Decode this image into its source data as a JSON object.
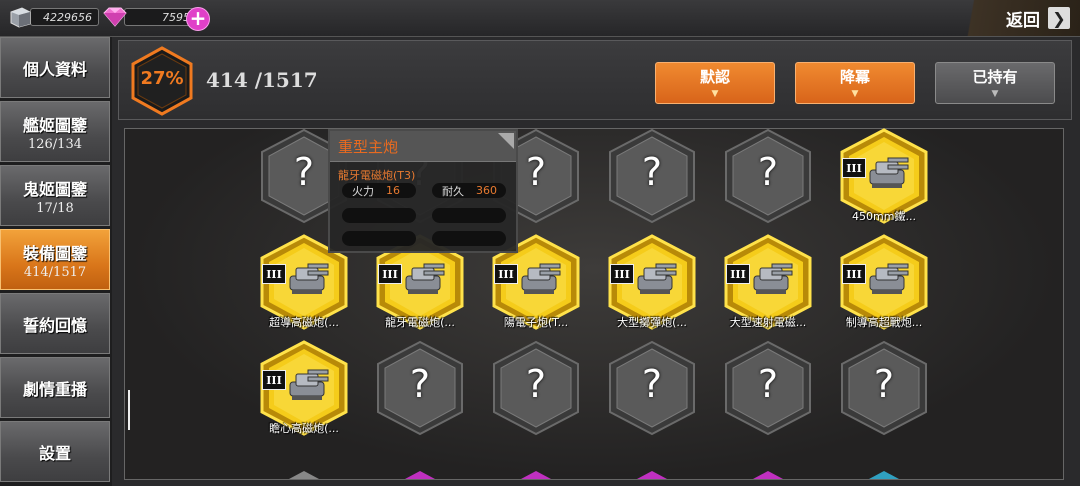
{
  "topbar": {
    "steel": "4229656",
    "gems": "7595",
    "gem_add_symbol": "+",
    "back_label": "返回",
    "back_arrow": "❯"
  },
  "sidebar": {
    "items": [
      {
        "label": "個人資料",
        "count": ""
      },
      {
        "label": "艦姬圖鑒",
        "count": "126/134"
      },
      {
        "label": "鬼姬圖鑒",
        "count": "17/18"
      },
      {
        "label": "裝備圖鑒",
        "count": "414/1517",
        "active": true
      },
      {
        "label": "誓約回憶",
        "count": ""
      },
      {
        "label": "劇情重播",
        "count": ""
      },
      {
        "label": "設置",
        "count": ""
      }
    ]
  },
  "header": {
    "percent": "27%",
    "count": "414 /1517",
    "buttons": [
      {
        "label": "默認",
        "style": "orange"
      },
      {
        "label": "降冪",
        "style": "orange"
      },
      {
        "label": "已持有",
        "style": "gray"
      }
    ],
    "dropdown_glyph": "▼"
  },
  "grid": {
    "unknown_glyph": "?",
    "tier_label": "III",
    "rows": [
      [
        {
          "state": "unknown"
        },
        {
          "state": "unknown"
        },
        {
          "state": "unknown"
        },
        {
          "state": "unknown"
        },
        {
          "state": "unknown"
        },
        {
          "state": "owned",
          "name": "450mm鐵..."
        }
      ],
      [
        {
          "state": "owned",
          "name": "超導高磁炮(..."
        },
        {
          "state": "owned",
          "name": "龍牙電磁炮(..."
        },
        {
          "state": "owned",
          "name": "陽電子炮(T..."
        },
        {
          "state": "owned",
          "name": "大型擲彈炮(..."
        },
        {
          "state": "owned",
          "name": "大型速射電磁..."
        },
        {
          "state": "owned",
          "name": "制導高超戰炮..."
        }
      ],
      [
        {
          "state": "owned",
          "name": "瞻心高磁炮(..."
        },
        {
          "state": "unknown"
        },
        {
          "state": "unknown"
        },
        {
          "state": "unknown"
        },
        {
          "state": "unknown"
        },
        {
          "state": "unknown"
        }
      ]
    ],
    "peek_colors": [
      "#888888",
      "#c030c0",
      "#c030c0",
      "#c030c0",
      "#c030c0",
      "#30a0c0"
    ]
  },
  "tooltip": {
    "category": "重型主炮",
    "item_name": "龍牙電磁炮(T3)",
    "stats": [
      {
        "key": "火力",
        "value": "16"
      },
      {
        "key": "耐久",
        "value": "360"
      },
      {
        "key": "",
        "value": ""
      },
      {
        "key": "",
        "value": ""
      },
      {
        "key": "",
        "value": ""
      },
      {
        "key": "",
        "value": ""
      }
    ]
  },
  "colors": {
    "accent_orange": "#f07a20",
    "gold_hex": "#f5cc1a",
    "active_nav": "#e8861e"
  }
}
